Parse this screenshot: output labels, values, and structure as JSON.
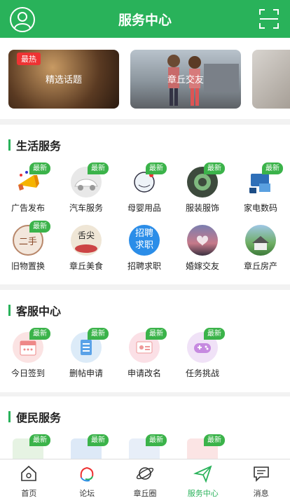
{
  "header": {
    "title": "服务中心"
  },
  "banners": [
    {
      "tag": "最热",
      "label": "精选话题"
    },
    {
      "tag": "",
      "label": "章丘交友"
    },
    {
      "tag": "",
      "label": ""
    }
  ],
  "sections": [
    {
      "title": "生活服务",
      "items": [
        {
          "name": "广告发布",
          "badge": "最新"
        },
        {
          "name": "汽车服务",
          "badge": "最新"
        },
        {
          "name": "母婴用品",
          "badge": "最新"
        },
        {
          "name": "服装服饰",
          "badge": "最新"
        },
        {
          "name": "家电数码",
          "badge": "最新"
        },
        {
          "name": "旧物置换",
          "badge": "最新",
          "icon_text": "二手"
        },
        {
          "name": "章丘美食",
          "badge": "",
          "icon_text": "舌尖"
        },
        {
          "name": "招聘求职",
          "badge": "",
          "icon_text": "招聘求职"
        },
        {
          "name": "婚嫁交友",
          "badge": ""
        },
        {
          "name": "章丘房产",
          "badge": ""
        }
      ]
    },
    {
      "title": "客服中心",
      "items": [
        {
          "name": "今日签到",
          "badge": "最新"
        },
        {
          "name": "删帖申请",
          "badge": "最新"
        },
        {
          "name": "申请改名",
          "badge": "最新"
        },
        {
          "name": "任务挑战",
          "badge": "最新"
        }
      ]
    },
    {
      "title": "便民服务",
      "items": [
        {
          "name": "",
          "badge": "最新"
        },
        {
          "name": "",
          "badge": "最新"
        },
        {
          "name": "",
          "badge": "最新"
        },
        {
          "name": "",
          "badge": "最新"
        }
      ]
    }
  ],
  "tabbar": [
    {
      "label": "首页",
      "active": false
    },
    {
      "label": "论坛",
      "active": false
    },
    {
      "label": "章丘圈",
      "active": false
    },
    {
      "label": "服务中心",
      "active": true
    },
    {
      "label": "消息",
      "active": false
    }
  ],
  "colors": {
    "brand": "#29b25a",
    "badge": "#3bb34a",
    "hot_tag": "#e33"
  }
}
